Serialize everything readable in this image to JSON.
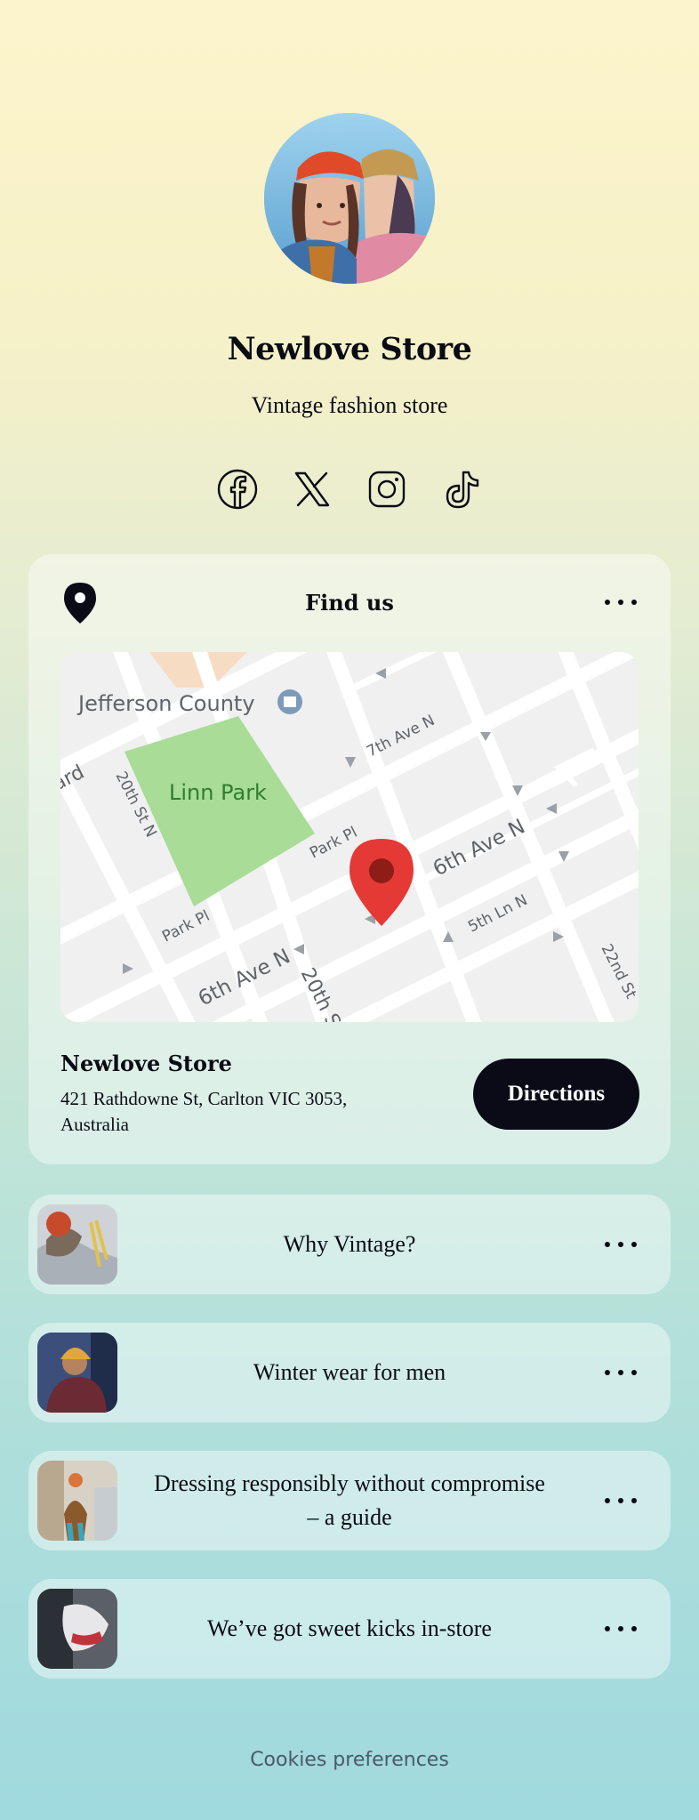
{
  "profile": {
    "name": "Newlove Store",
    "tagline": "Vintage fashion store"
  },
  "socials": [
    {
      "icon": "facebook-icon"
    },
    {
      "icon": "x-icon"
    },
    {
      "icon": "instagram-icon"
    },
    {
      "icon": "tiktok-icon"
    }
  ],
  "find_us": {
    "title": "Find us",
    "map": {
      "labels": {
        "jefferson": "Jefferson County",
        "park": "Linn Park",
        "ave7": "7th Ave N",
        "st20": "20th St N",
        "parkpl1": "Park Pl",
        "parkpl2": "Park Pl",
        "ave6a": "6th Ave N",
        "ave6b": "6th Ave N",
        "ln5": "5th Ln N",
        "st20b": "20th S",
        "st22": "22nd St",
        "ard": "ard"
      }
    },
    "store_name": "Newlove Store",
    "address": "421 Rathdowne St, Carlton VIC 3053, Australia",
    "directions_label": "Directions"
  },
  "links": [
    {
      "label": "Why Vintage?"
    },
    {
      "label": "Winter wear for men"
    },
    {
      "label": "Dressing responsibly without compromise – a guide"
    },
    {
      "label": "We’ve got sweet kicks in-store"
    }
  ],
  "footer": {
    "cookies": "Cookies preferences"
  },
  "colors": {
    "accent": "#0b0b17",
    "pin": "#e53935"
  }
}
